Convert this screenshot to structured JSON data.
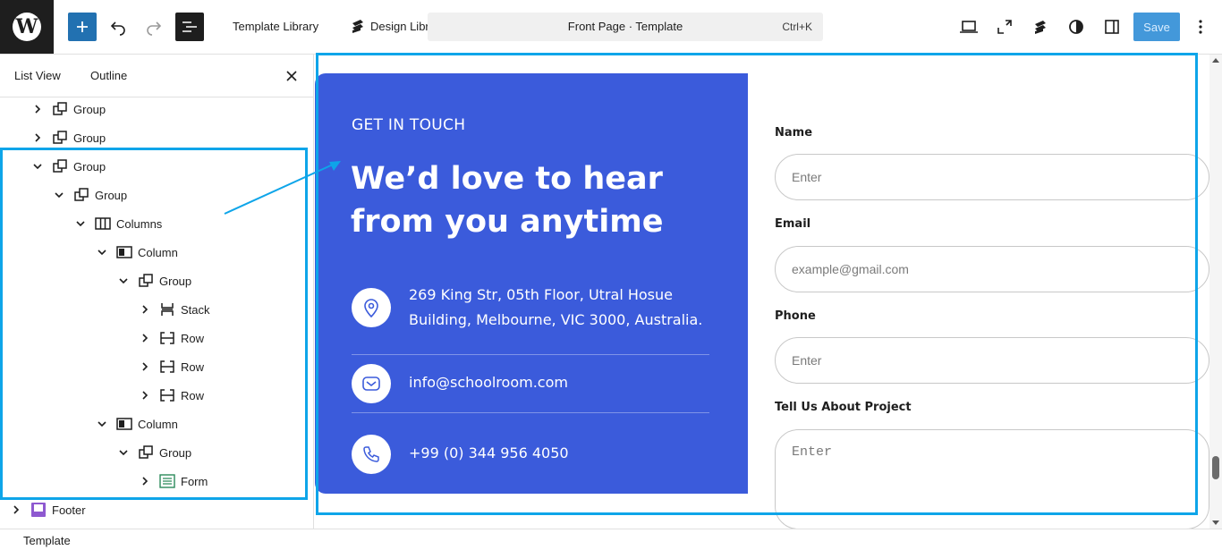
{
  "colors": {
    "accent": "#2271b1",
    "card_blue": "#3b5bdb",
    "highlight": "#0ea5e9",
    "icon_blue": "#3b5bdb"
  },
  "topbar": {
    "logo_icon": "wordpress-logo",
    "add_icon": "plus-icon",
    "undo_icon": "undo-icon",
    "redo_icon": "redo-icon",
    "list_icon": "document-overview-icon",
    "template_library_label": "Template Library",
    "design_library_label": "Design Library",
    "document_title": "Front Page · Template",
    "shortcut": "Ctrl+K",
    "save_label": "Save"
  },
  "sidebar": {
    "tabs": [
      {
        "label": "List View"
      },
      {
        "label": "Outline"
      }
    ],
    "items": [
      {
        "label": "Group",
        "icon": "group-icon",
        "expanded": false
      },
      {
        "label": "Group",
        "icon": "group-icon",
        "expanded": false
      },
      {
        "label": "Group",
        "icon": "group-icon",
        "expanded": true
      },
      {
        "label": "Group",
        "icon": "group-icon",
        "expanded": true
      },
      {
        "label": "Columns",
        "icon": "columns-icon",
        "expanded": true
      },
      {
        "label": "Column",
        "icon": "column-icon",
        "expanded": true
      },
      {
        "label": "Group",
        "icon": "group-icon",
        "expanded": true
      },
      {
        "label": "Stack",
        "icon": "stack-icon",
        "expanded": false
      },
      {
        "label": "Row",
        "icon": "row-icon",
        "expanded": false
      },
      {
        "label": "Row",
        "icon": "row-icon",
        "expanded": false
      },
      {
        "label": "Row",
        "icon": "row-icon",
        "expanded": false
      },
      {
        "label": "Column",
        "icon": "column-icon",
        "expanded": true
      },
      {
        "label": "Group",
        "icon": "group-icon",
        "expanded": true
      },
      {
        "label": "Form",
        "icon": "form-icon",
        "expanded": false
      },
      {
        "label": "Footer",
        "icon": "footer-icon",
        "expanded": false
      }
    ]
  },
  "status": {
    "breadcrumb": "Template"
  },
  "canvas": {
    "eyebrow": "GET IN TOUCH",
    "headline": "We’d love to hear from you anytime",
    "contacts": [
      {
        "icon": "location-pin-icon",
        "text": "269 King Str, 05th Floor, Utral Hosue Building, Melbourne, VIC 3000, Australia."
      },
      {
        "icon": "envelope-icon",
        "text": "info@schoolroom.com"
      },
      {
        "icon": "phone-icon",
        "text": "+99 (0) 344 956 4050"
      }
    ],
    "form": {
      "name_label": "Name",
      "name_placeholder": "Enter",
      "email_label": "Email",
      "email_placeholder": "example@gmail.com",
      "phone_label": "Phone",
      "phone_placeholder": "Enter",
      "project_label": "Tell Us About Project",
      "project_placeholder": "Enter"
    }
  }
}
